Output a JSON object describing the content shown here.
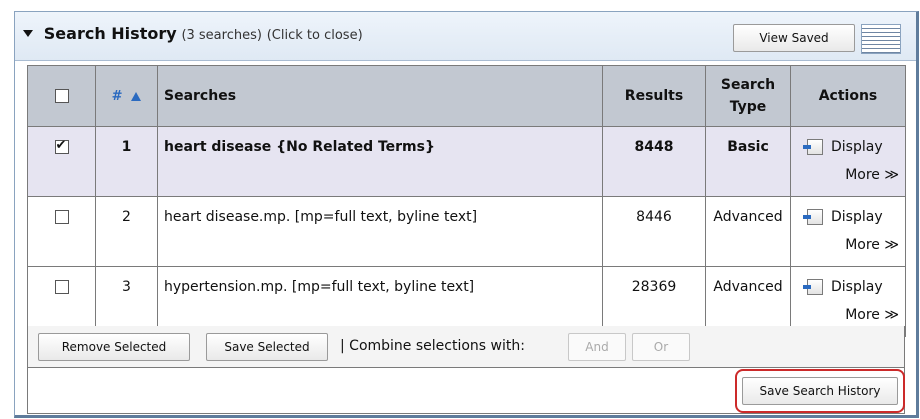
{
  "header": {
    "title": "Search History",
    "count": "(3 searches)",
    "close": "(Click to close)",
    "view_saved_label": "View Saved"
  },
  "table": {
    "columns": {
      "number": "#",
      "searches": "Searches",
      "results": "Results",
      "search_type": "Search Type",
      "actions": "Actions"
    },
    "rows": [
      {
        "checked": true,
        "number": "1",
        "search": "heart disease {No Related Terms}",
        "results": "8448",
        "type": "Basic",
        "display": "Display",
        "more": "More ≫"
      },
      {
        "checked": false,
        "number": "2",
        "search": "heart disease.mp. [mp=full text, byline text]",
        "results": "8446",
        "type": "Advanced",
        "display": "Display",
        "more": "More ≫"
      },
      {
        "checked": false,
        "number": "3",
        "search": "hypertension.mp. [mp=full text, byline text]",
        "results": "28369",
        "type": "Advanced",
        "display": "Display",
        "more": "More ≫"
      }
    ]
  },
  "footer": {
    "remove_selected": "Remove Selected",
    "save_selected": "Save Selected",
    "combine_label": "| Combine selections with:",
    "and_label": "And",
    "or_label": "Or",
    "save_search_history": "Save Search History"
  },
  "colors": {
    "header_bg": "#dfe9f4",
    "table_header_bg": "#c2c8d1",
    "selected_row_bg": "#e6e4f1",
    "highlight": "#cc2a2a",
    "accent": "#2a6ac0"
  },
  "icons": [
    "expand-triangle-icon",
    "sort-ascending-icon",
    "display-icon",
    "list-lines-icon"
  ]
}
